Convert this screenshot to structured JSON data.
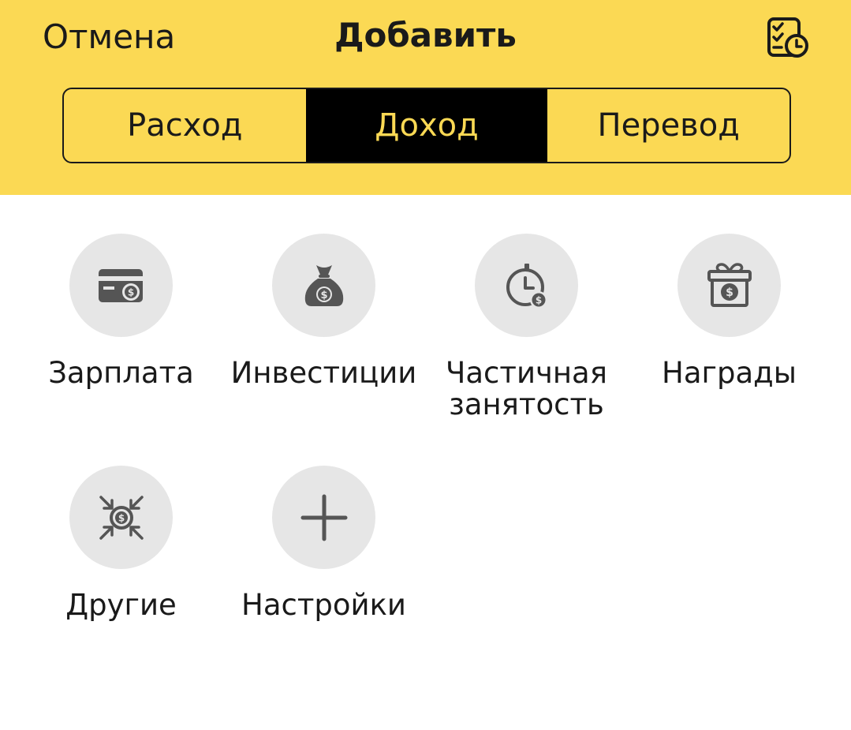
{
  "header": {
    "cancel_label": "Отмена",
    "title": "Добавить",
    "schedule_icon": "checklist-clock-icon"
  },
  "tabs": [
    {
      "label": "Расход",
      "active": false
    },
    {
      "label": "Доход",
      "active": true
    },
    {
      "label": "Перевод",
      "active": false
    }
  ],
  "categories": [
    {
      "label": "Зарплата",
      "icon": "salary-card-icon"
    },
    {
      "label": "Инвестиции",
      "icon": "money-bag-icon"
    },
    {
      "label": "Частичная\nзанятость",
      "icon": "clock-dollar-icon"
    },
    {
      "label": "Награды",
      "icon": "gift-dollar-icon"
    },
    {
      "label": "Другие",
      "icon": "arrows-dollar-icon"
    },
    {
      "label": "Настройки",
      "icon": "plus-icon"
    }
  ],
  "colors": {
    "header_bg": "#fbd954",
    "active_tab_bg": "#000000",
    "active_tab_text": "#fbd954",
    "icon_circle_bg": "#e6e6e6",
    "icon_fg": "#555555"
  }
}
